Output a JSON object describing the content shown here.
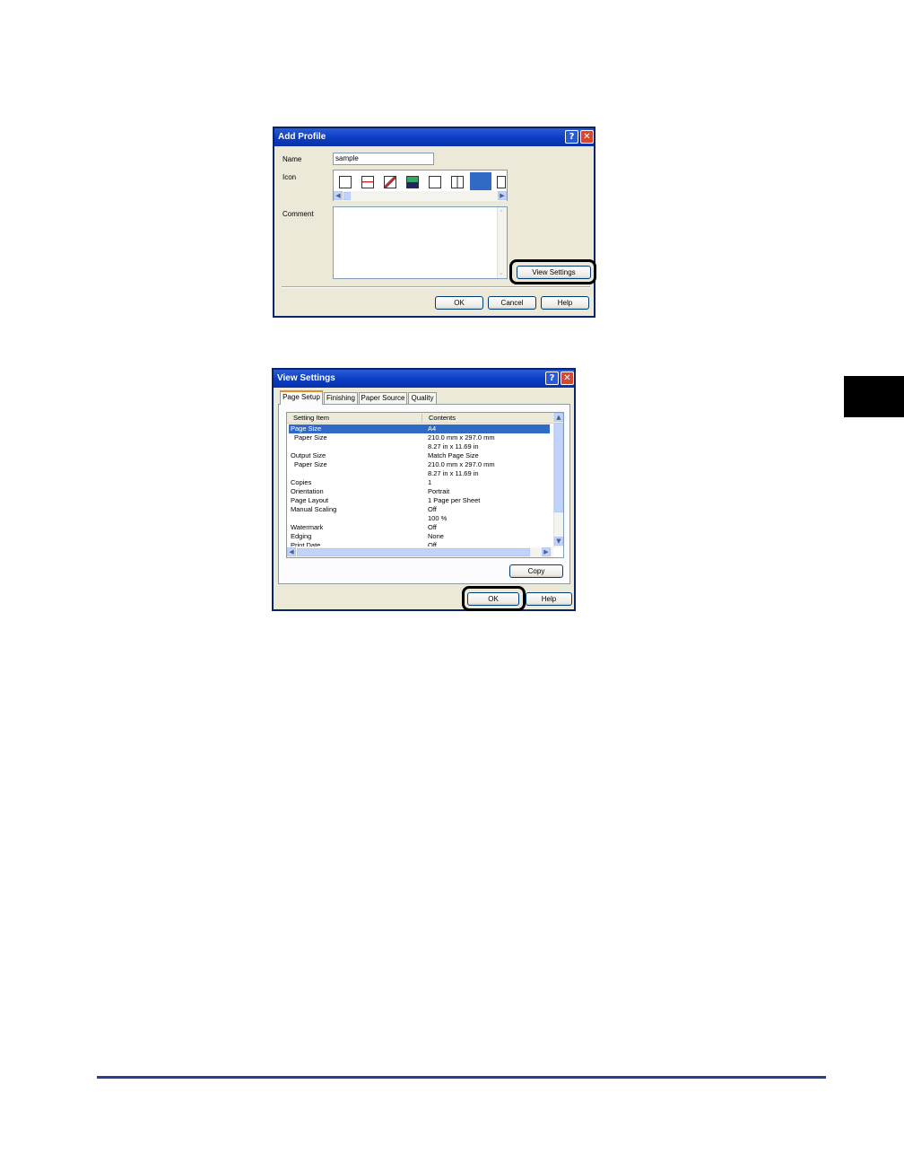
{
  "add_profile": {
    "title": "Add Profile",
    "name_label": "Name",
    "name_value": "sample",
    "icon_label": "Icon",
    "comment_label": "Comment",
    "view_settings_button": "View Settings",
    "ok_button": "OK",
    "cancel_button": "Cancel",
    "help_button": "Help",
    "help_icon": "?",
    "close_icon": "✕"
  },
  "view_settings": {
    "title": "View Settings",
    "tabs": [
      "Page Setup",
      "Finishing",
      "Paper Source",
      "Quality"
    ],
    "columns": [
      "Setting Item",
      "Contents"
    ],
    "rows": [
      {
        "item": "Page Size",
        "contents": "A4",
        "selected": true
      },
      {
        "item": "Paper Size",
        "contents": "210.0 mm x 297.0 mm",
        "indent": true
      },
      {
        "item": "",
        "contents": "8.27 in x 11.69 in"
      },
      {
        "item": "Output Size",
        "contents": "Match Page Size"
      },
      {
        "item": "Paper Size",
        "contents": "210.0 mm x 297.0 mm",
        "indent": true
      },
      {
        "item": "",
        "contents": "8.27 in x 11.69 in"
      },
      {
        "item": "Copies",
        "contents": "1"
      },
      {
        "item": "Orientation",
        "contents": "Portrait"
      },
      {
        "item": "Page Layout",
        "contents": "1 Page per Sheet"
      },
      {
        "item": "Manual Scaling",
        "contents": "Off"
      },
      {
        "item": "",
        "contents": "100 %"
      },
      {
        "item": "Watermark",
        "contents": "Off"
      },
      {
        "item": "Edging",
        "contents": "None"
      },
      {
        "item": "Print Date",
        "contents": "Off"
      }
    ],
    "copy_button": "Copy",
    "ok_button": "OK",
    "help_button": "Help",
    "help_icon": "?",
    "close_icon": "✕"
  },
  "colors": {
    "footer_rule": "#2b3f8c",
    "chapter_tab": "#000000",
    "title_bar": "#0a3cc2",
    "selection": "#316ac5"
  }
}
